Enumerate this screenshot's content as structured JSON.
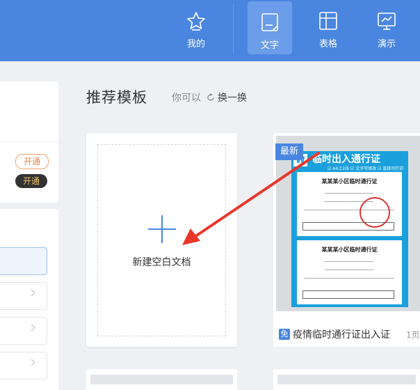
{
  "nav": {
    "items": [
      {
        "label": "我的",
        "icon": "star-icon"
      },
      {
        "label": "文字",
        "icon": "document-icon"
      },
      {
        "label": "表格",
        "icon": "table-icon"
      },
      {
        "label": "演示",
        "icon": "presentation-icon"
      }
    ],
    "active": "文字"
  },
  "left_panel": {
    "open_outline_label": "开通",
    "open_dark_label": "开通"
  },
  "main": {
    "section_title": "推荐模板",
    "hint": "你可以",
    "refresh_label": "换一换",
    "blank_doc_label": "新建空白文档"
  },
  "template": {
    "badge": "最新",
    "free_badge": "免",
    "title": "疫情临时通行证出入证",
    "pages": "1页",
    "poster_title": "临时出入通行证",
    "poster_icon_text": "W",
    "poster_subtitle": "☑ A4上2张   ☑ 文字可修改   ☑ 直接可打印",
    "pass_title": "某某某小区临时通行证",
    "accent": "#4a86e0",
    "poster_color": "#1aa0dc"
  },
  "annotation": {
    "arrow_color": "#e8372b"
  }
}
